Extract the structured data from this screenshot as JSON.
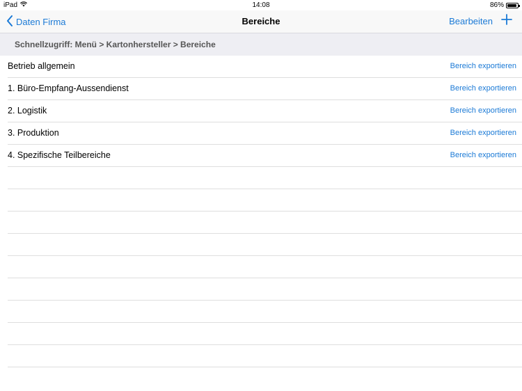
{
  "status_bar": {
    "device": "iPad",
    "time": "14:08",
    "battery": "86%"
  },
  "nav": {
    "back_label": "Daten Firma",
    "title": "Bereiche",
    "edit_label": "Bearbeiten"
  },
  "section": {
    "header": "Schnellzugriff:  Menü > Kartonhersteller > Bereiche"
  },
  "rows": [
    {
      "label": "Betrieb allgemein",
      "action": "Bereich exportieren"
    },
    {
      "label": "1. Büro-Empfang-Aussendienst",
      "action": "Bereich exportieren"
    },
    {
      "label": "2. Logistik",
      "action": "Bereich exportieren"
    },
    {
      "label": "3. Produktion",
      "action": "Bereich exportieren"
    },
    {
      "label": "4. Spezifische Teilbereiche",
      "action": "Bereich exportieren"
    }
  ],
  "colors": {
    "accent": "#1b7ad6",
    "section_bg": "#eeeef3"
  }
}
